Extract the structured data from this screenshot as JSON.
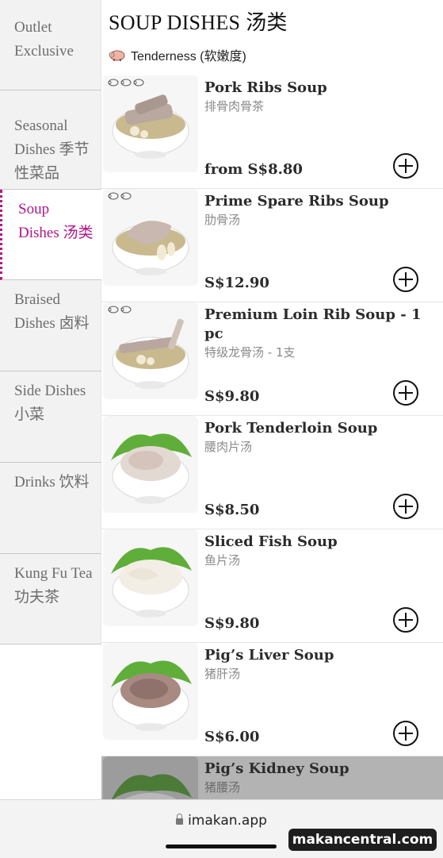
{
  "sidebar": {
    "items": [
      {
        "label": "Outlet Exclusive",
        "active": false
      },
      {
        "label": "Seasonal Dishes 季节性菜品",
        "active": false
      },
      {
        "label": "Soup Dishes 汤类",
        "active": true
      },
      {
        "label": "Braised Dishes 卤料",
        "active": false
      },
      {
        "label": "Side Dishes 小菜",
        "active": false
      },
      {
        "label": "Drinks 饮料",
        "active": false
      },
      {
        "label": "Kung Fu Tea 功夫茶",
        "active": false
      }
    ]
  },
  "main": {
    "title": "SOUP DISHES 汤类",
    "legend": {
      "icon": "pig-icon",
      "label": "Tenderness (软嫩度)"
    },
    "items": [
      {
        "name": "Pork Ribs Soup",
        "cname": "排骨肉骨茶",
        "price": "from S$8.80",
        "tenderness": 3
      },
      {
        "name": "Prime Spare Ribs Soup",
        "cname": "肋骨汤",
        "price": "S$12.90",
        "tenderness": 2
      },
      {
        "name": "Premium Loin Rib Soup - 1 pc",
        "cname": "特级龙骨汤 - 1支",
        "price": "S$9.80",
        "tenderness": 2
      },
      {
        "name": "Pork Tenderloin Soup",
        "cname": "腰肉片汤",
        "price": "S$8.50",
        "tenderness": 0
      },
      {
        "name": "Sliced Fish Soup",
        "cname": "鱼片汤",
        "price": "S$9.80",
        "tenderness": 0
      },
      {
        "name": "Pig’s Liver Soup",
        "cname": "猪肝汤",
        "price": "S$6.00",
        "tenderness": 0
      },
      {
        "name": "Pig’s Kidney Soup",
        "cname": "猪腰汤",
        "price": "",
        "tenderness": 0
      }
    ]
  },
  "browser": {
    "url": "imakan.app"
  },
  "watermark": "makancentral.com",
  "colors": {
    "accent": "#b0168a",
    "text": "#2b2b2b",
    "muted": "#8a8a8a"
  }
}
